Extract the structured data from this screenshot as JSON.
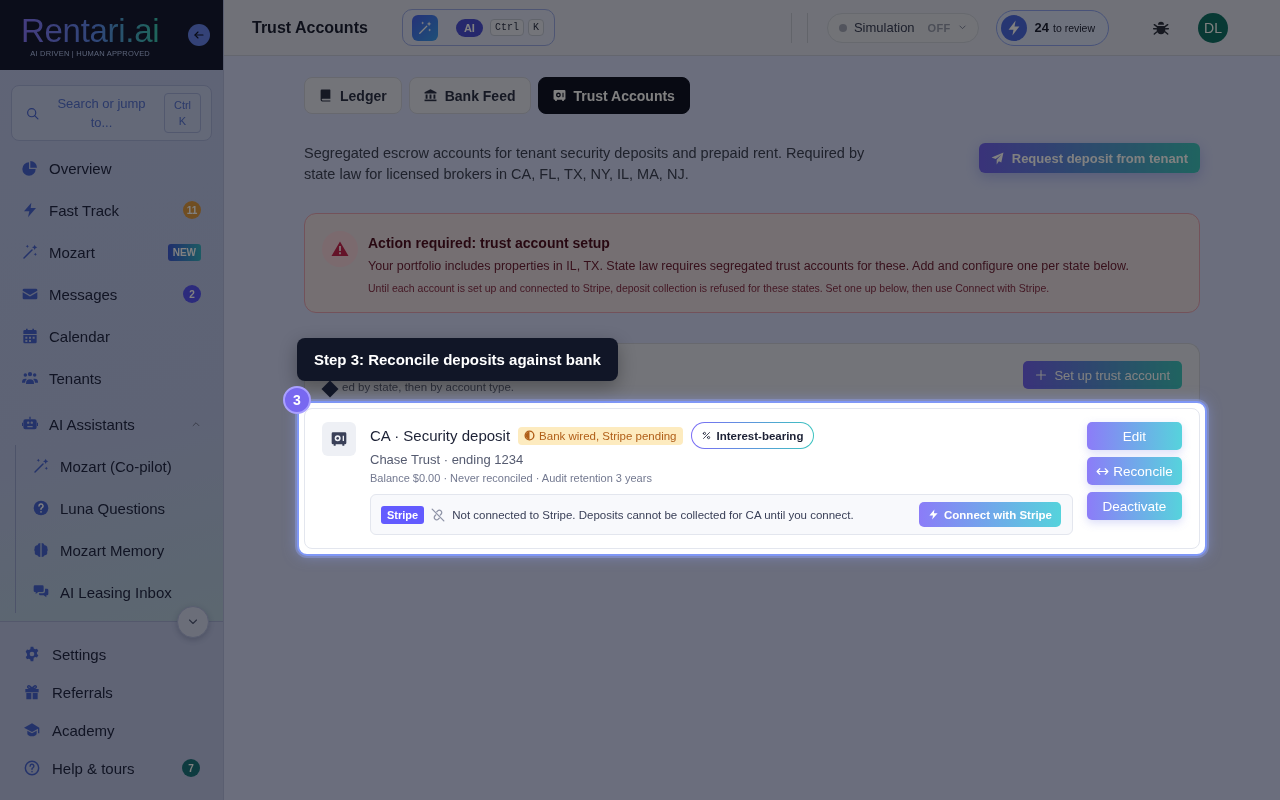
{
  "sidebar": {
    "logo": {
      "name": "Rentari.ai",
      "tagline": "AI DRIVEN | HUMAN APPROVED"
    },
    "search": {
      "placeholder": "Search or jump to...",
      "shortcut": "Ctrl K"
    },
    "nav": [
      {
        "label": "Overview"
      },
      {
        "label": "Fast Track",
        "badge": {
          "kind": "count",
          "text": "11",
          "color": "#704e22"
        }
      },
      {
        "label": "Mozart",
        "badge": {
          "kind": "tag",
          "text": "NEW"
        }
      },
      {
        "label": "Messages",
        "badge": {
          "kind": "count",
          "text": "2",
          "color": "#2c2b7c"
        }
      },
      {
        "label": "Calendar"
      },
      {
        "label": "Tenants"
      },
      {
        "label": "AI Assistants",
        "expanded": true,
        "children": [
          {
            "label": "Mozart (Co-pilot)"
          },
          {
            "label": "Luna Questions"
          },
          {
            "label": "Mozart Memory"
          },
          {
            "label": "AI Leasing Inbox"
          }
        ]
      }
    ],
    "bottom_nav": [
      {
        "label": "Settings"
      },
      {
        "label": "Referrals"
      },
      {
        "label": "Academy"
      },
      {
        "label": "Help & tours",
        "badge": {
          "kind": "count",
          "text": "7",
          "color": "#0e3b40"
        }
      }
    ]
  },
  "topbar": {
    "title": "Trust Accounts",
    "ai_command": {
      "badge": "AI",
      "keys": [
        "Ctrl",
        "K"
      ]
    },
    "simulation": {
      "label": "Simulation",
      "state": "OFF",
      "on": false
    },
    "review": {
      "count": "24",
      "label": "to review"
    },
    "avatar": "DL"
  },
  "tabs": [
    {
      "label": "Ledger",
      "selected": false
    },
    {
      "label": "Bank Feed",
      "selected": false
    },
    {
      "label": "Trust Accounts",
      "selected": true
    }
  ],
  "intro": {
    "text": "Segregated escrow accounts for tenant security deposits and prepaid rent. Required by state law for licensed brokers in CA, FL, TX, NY, IL, MA, NJ.",
    "button": "Request deposit from tenant"
  },
  "alert": {
    "title": "Action required: trust account setup",
    "message": "Your portfolio includes properties in IL, TX. State law requires segregated trust accounts for these. Add and configure one per state below.",
    "note": "Until each account is set up and connected to Stripe, deposit collection is refused for these states. Set one up below, then use Connect with Stripe."
  },
  "section": {
    "subtitle": "ed by state, then by account type.",
    "button": "Set up trust account"
  },
  "tour": {
    "step": "3",
    "title": "Step 3: Reconcile deposits against bank"
  },
  "accounts": [
    {
      "highlighted": true,
      "title": "CA · Security deposit",
      "status": {
        "kind": "pending",
        "text": "Bank wired, Stripe pending"
      },
      "tag": "Interest-bearing",
      "bank": "Chase Trust · ending 1234",
      "meta": "Balance $0.00 · Never reconciled · Audit retention 3 years",
      "stripe": {
        "badge": "Stripe",
        "connected": false,
        "message": "Not connected to Stripe. Deposits cannot be collected for CA until you connect.",
        "button": "Connect with Stripe"
      },
      "actions": [
        {
          "label": "Edit",
          "kind": "plain"
        },
        {
          "label": "Reconcile",
          "kind": "icon"
        },
        {
          "label": "Deactivate",
          "kind": "plain"
        }
      ]
    }
  ]
}
